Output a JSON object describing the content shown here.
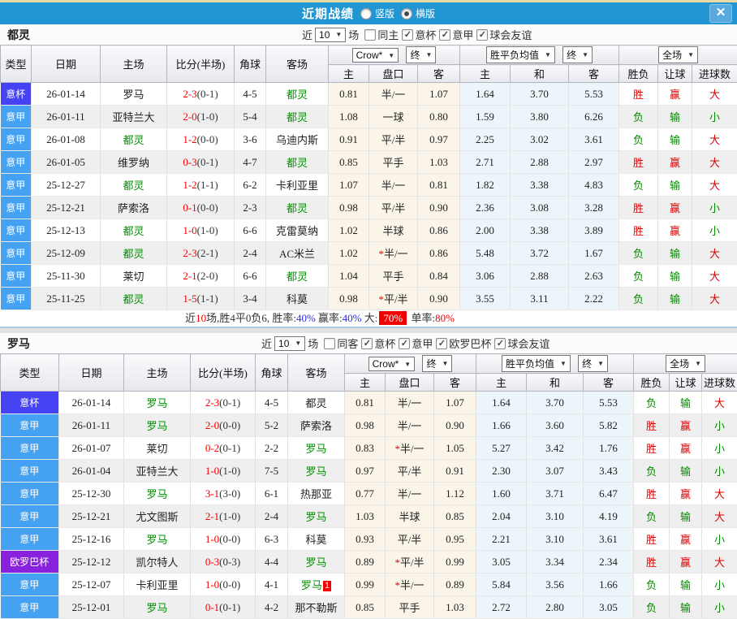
{
  "titlebar": {
    "title": "近期战绩",
    "layout_options": [
      {
        "label": "竖版",
        "selected": false
      },
      {
        "label": "横版",
        "selected": true
      }
    ],
    "close": "✕"
  },
  "colors": {
    "titlebar_bg": "#2196d3",
    "league": {
      "意甲": "#45a1f1",
      "意杯": "#4442f2",
      "欧罗巴杯": "#8a22dd"
    },
    "win_red": "#dd0000",
    "lose_green": "#038a00",
    "team_green": "#009100",
    "score_red": "#f40000",
    "odds_col_bg": "#fbf5e9",
    "mean_col_bg": "#ecf5fa"
  },
  "table_header": {
    "cols": [
      "类型",
      "日期",
      "主场",
      "比分(半场)",
      "角球",
      "客场"
    ],
    "odds_group": {
      "source": "Crow*",
      "time": "终"
    },
    "mean_group": {
      "source": "胜平负均值",
      "time": "终"
    },
    "result_group": {
      "scope": "全场"
    },
    "sub": [
      "主",
      "盘口",
      "客",
      "主",
      "和",
      "客",
      "胜负",
      "让球",
      "进球数"
    ]
  },
  "teams": [
    {
      "name": "都灵",
      "filters": {
        "near": "近",
        "count": "10",
        "games": "场",
        "checks": [
          {
            "label": "同主",
            "checked": false
          },
          {
            "label": "意杯",
            "checked": true
          },
          {
            "label": "意甲",
            "checked": true
          },
          {
            "label": "球会友谊",
            "checked": true
          }
        ]
      },
      "rows": [
        {
          "league": "意杯",
          "date": "26-01-14",
          "home": "罗马",
          "homeGreen": false,
          "score": "2-3",
          "half": "(0-1)",
          "corner": "4-5",
          "away": "都灵",
          "awayGreen": true,
          "awayBadge": null,
          "oddsHome": "0.81",
          "handicap": "半/一",
          "handicapStar": false,
          "oddsAway": "1.07",
          "meanHome": "1.64",
          "meanDraw": "3.70",
          "meanAway": "5.53",
          "resWDL": "胜",
          "resHandicap": "赢",
          "resGoals": "大"
        },
        {
          "league": "意甲",
          "date": "26-01-11",
          "home": "亚特兰大",
          "homeGreen": false,
          "score": "2-0",
          "half": "(1-0)",
          "corner": "5-4",
          "away": "都灵",
          "awayGreen": true,
          "awayBadge": null,
          "oddsHome": "1.08",
          "handicap": "一球",
          "handicapStar": false,
          "oddsAway": "0.80",
          "meanHome": "1.59",
          "meanDraw": "3.80",
          "meanAway": "6.26",
          "resWDL": "负",
          "resHandicap": "输",
          "resGoals": "小"
        },
        {
          "league": "意甲",
          "date": "26-01-08",
          "home": "都灵",
          "homeGreen": true,
          "score": "1-2",
          "half": "(0-0)",
          "corner": "3-6",
          "away": "乌迪内斯",
          "awayGreen": false,
          "awayBadge": null,
          "oddsHome": "0.91",
          "handicap": "平/半",
          "handicapStar": false,
          "oddsAway": "0.97",
          "meanHome": "2.25",
          "meanDraw": "3.02",
          "meanAway": "3.61",
          "resWDL": "负",
          "resHandicap": "输",
          "resGoals": "大"
        },
        {
          "league": "意甲",
          "date": "26-01-05",
          "home": "维罗纳",
          "homeGreen": false,
          "score": "0-3",
          "half": "(0-1)",
          "corner": "4-7",
          "away": "都灵",
          "awayGreen": true,
          "awayBadge": null,
          "oddsHome": "0.85",
          "handicap": "平手",
          "handicapStar": false,
          "oddsAway": "1.03",
          "meanHome": "2.71",
          "meanDraw": "2.88",
          "meanAway": "2.97",
          "resWDL": "胜",
          "resHandicap": "赢",
          "resGoals": "大"
        },
        {
          "league": "意甲",
          "date": "25-12-27",
          "home": "都灵",
          "homeGreen": true,
          "score": "1-2",
          "half": "(1-1)",
          "corner": "6-2",
          "away": "卡利亚里",
          "awayGreen": false,
          "awayBadge": null,
          "oddsHome": "1.07",
          "handicap": "半/一",
          "handicapStar": false,
          "oddsAway": "0.81",
          "meanHome": "1.82",
          "meanDraw": "3.38",
          "meanAway": "4.83",
          "resWDL": "负",
          "resHandicap": "输",
          "resGoals": "大"
        },
        {
          "league": "意甲",
          "date": "25-12-21",
          "home": "萨索洛",
          "homeGreen": false,
          "score": "0-1",
          "half": "(0-0)",
          "corner": "2-3",
          "away": "都灵",
          "awayGreen": true,
          "awayBadge": null,
          "oddsHome": "0.98",
          "handicap": "平/半",
          "handicapStar": false,
          "oddsAway": "0.90",
          "meanHome": "2.36",
          "meanDraw": "3.08",
          "meanAway": "3.28",
          "resWDL": "胜",
          "resHandicap": "赢",
          "resGoals": "小"
        },
        {
          "league": "意甲",
          "date": "25-12-13",
          "home": "都灵",
          "homeGreen": true,
          "score": "1-0",
          "half": "(1-0)",
          "corner": "6-6",
          "away": "克雷莫纳",
          "awayGreen": false,
          "awayBadge": null,
          "oddsHome": "1.02",
          "handicap": "半球",
          "handicapStar": false,
          "oddsAway": "0.86",
          "meanHome": "2.00",
          "meanDraw": "3.38",
          "meanAway": "3.89",
          "resWDL": "胜",
          "resHandicap": "赢",
          "resGoals": "小"
        },
        {
          "league": "意甲",
          "date": "25-12-09",
          "home": "都灵",
          "homeGreen": true,
          "score": "2-3",
          "half": "(2-1)",
          "corner": "2-4",
          "away": "AC米兰",
          "awayGreen": false,
          "awayBadge": null,
          "oddsHome": "1.02",
          "handicap": "半/一",
          "handicapStar": true,
          "oddsAway": "0.86",
          "meanHome": "5.48",
          "meanDraw": "3.72",
          "meanAway": "1.67",
          "resWDL": "负",
          "resHandicap": "输",
          "resGoals": "大"
        },
        {
          "league": "意甲",
          "date": "25-11-30",
          "home": "莱切",
          "homeGreen": false,
          "score": "2-1",
          "half": "(2-0)",
          "corner": "6-6",
          "away": "都灵",
          "awayGreen": true,
          "awayBadge": null,
          "oddsHome": "1.04",
          "handicap": "平手",
          "handicapStar": false,
          "oddsAway": "0.84",
          "meanHome": "3.06",
          "meanDraw": "2.88",
          "meanAway": "2.63",
          "resWDL": "负",
          "resHandicap": "输",
          "resGoals": "大"
        },
        {
          "league": "意甲",
          "date": "25-11-25",
          "home": "都灵",
          "homeGreen": true,
          "score": "1-5",
          "half": "(1-1)",
          "corner": "3-4",
          "away": "科莫",
          "awayGreen": false,
          "awayBadge": null,
          "oddsHome": "0.98",
          "handicap": "平/半",
          "handicapStar": true,
          "oddsAway": "0.90",
          "meanHome": "3.55",
          "meanDraw": "3.11",
          "meanAway": "2.22",
          "resWDL": "负",
          "resHandicap": "输",
          "resGoals": "大"
        }
      ],
      "summary": [
        {
          "t": "近",
          "s": "k"
        },
        {
          "t": "10",
          "s": "r"
        },
        {
          "t": "场,胜4平0负6, 胜率:",
          "s": "k"
        },
        {
          "t": "40%",
          "s": "b"
        },
        {
          "t": " 赢率:",
          "s": "k"
        },
        {
          "t": "40%",
          "s": "b"
        },
        {
          "t": " 大:",
          "s": "k"
        },
        {
          "t": "70%",
          "s": "badge"
        },
        {
          "t": " 单率:",
          "s": "k"
        },
        {
          "t": "80%",
          "s": "r"
        }
      ]
    },
    {
      "name": "罗马",
      "filters": {
        "near": "近",
        "count": "10",
        "games": "场",
        "checks": [
          {
            "label": "同客",
            "checked": false
          },
          {
            "label": "意杯",
            "checked": true
          },
          {
            "label": "意甲",
            "checked": true
          },
          {
            "label": "欧罗巴杯",
            "checked": true
          },
          {
            "label": "球会友谊",
            "checked": true
          }
        ]
      },
      "rows": [
        {
          "league": "意杯",
          "date": "26-01-14",
          "home": "罗马",
          "homeGreen": true,
          "score": "2-3",
          "half": "(0-1)",
          "corner": "4-5",
          "away": "都灵",
          "awayGreen": false,
          "awayBadge": null,
          "oddsHome": "0.81",
          "handicap": "半/一",
          "handicapStar": false,
          "oddsAway": "1.07",
          "meanHome": "1.64",
          "meanDraw": "3.70",
          "meanAway": "5.53",
          "resWDL": "负",
          "resHandicap": "输",
          "resGoals": "大"
        },
        {
          "league": "意甲",
          "date": "26-01-11",
          "home": "罗马",
          "homeGreen": true,
          "score": "2-0",
          "half": "(0-0)",
          "corner": "5-2",
          "away": "萨索洛",
          "awayGreen": false,
          "awayBadge": null,
          "oddsHome": "0.98",
          "handicap": "半/一",
          "handicapStar": false,
          "oddsAway": "0.90",
          "meanHome": "1.66",
          "meanDraw": "3.60",
          "meanAway": "5.82",
          "resWDL": "胜",
          "resHandicap": "赢",
          "resGoals": "小"
        },
        {
          "league": "意甲",
          "date": "26-01-07",
          "home": "莱切",
          "homeGreen": false,
          "score": "0-2",
          "half": "(0-1)",
          "corner": "2-2",
          "away": "罗马",
          "awayGreen": true,
          "awayBadge": null,
          "oddsHome": "0.83",
          "handicap": "半/一",
          "handicapStar": true,
          "oddsAway": "1.05",
          "meanHome": "5.27",
          "meanDraw": "3.42",
          "meanAway": "1.76",
          "resWDL": "胜",
          "resHandicap": "赢",
          "resGoals": "小"
        },
        {
          "league": "意甲",
          "date": "26-01-04",
          "home": "亚特兰大",
          "homeGreen": false,
          "score": "1-0",
          "half": "(1-0)",
          "corner": "7-5",
          "away": "罗马",
          "awayGreen": true,
          "awayBadge": null,
          "oddsHome": "0.97",
          "handicap": "平/半",
          "handicapStar": false,
          "oddsAway": "0.91",
          "meanHome": "2.30",
          "meanDraw": "3.07",
          "meanAway": "3.43",
          "resWDL": "负",
          "resHandicap": "输",
          "resGoals": "小"
        },
        {
          "league": "意甲",
          "date": "25-12-30",
          "home": "罗马",
          "homeGreen": true,
          "score": "3-1",
          "half": "(3-0)",
          "corner": "6-1",
          "away": "热那亚",
          "awayGreen": false,
          "awayBadge": null,
          "oddsHome": "0.77",
          "handicap": "半/一",
          "handicapStar": false,
          "oddsAway": "1.12",
          "meanHome": "1.60",
          "meanDraw": "3.71",
          "meanAway": "6.47",
          "resWDL": "胜",
          "resHandicap": "赢",
          "resGoals": "大"
        },
        {
          "league": "意甲",
          "date": "25-12-21",
          "home": "尤文图斯",
          "homeGreen": false,
          "score": "2-1",
          "half": "(1-0)",
          "corner": "2-4",
          "away": "罗马",
          "awayGreen": true,
          "awayBadge": null,
          "oddsHome": "1.03",
          "handicap": "半球",
          "handicapStar": false,
          "oddsAway": "0.85",
          "meanHome": "2.04",
          "meanDraw": "3.10",
          "meanAway": "4.19",
          "resWDL": "负",
          "resHandicap": "输",
          "resGoals": "大"
        },
        {
          "league": "意甲",
          "date": "25-12-16",
          "home": "罗马",
          "homeGreen": true,
          "score": "1-0",
          "half": "(0-0)",
          "corner": "6-3",
          "away": "科莫",
          "awayGreen": false,
          "awayBadge": null,
          "oddsHome": "0.93",
          "handicap": "平/半",
          "handicapStar": false,
          "oddsAway": "0.95",
          "meanHome": "2.21",
          "meanDraw": "3.10",
          "meanAway": "3.61",
          "resWDL": "胜",
          "resHandicap": "赢",
          "resGoals": "小"
        },
        {
          "league": "欧罗巴杯",
          "date": "25-12-12",
          "home": "凯尔特人",
          "homeGreen": false,
          "score": "0-3",
          "half": "(0-3)",
          "corner": "4-4",
          "away": "罗马",
          "awayGreen": true,
          "awayBadge": null,
          "oddsHome": "0.89",
          "handicap": "平/半",
          "handicapStar": true,
          "oddsAway": "0.99",
          "meanHome": "3.05",
          "meanDraw": "3.34",
          "meanAway": "2.34",
          "resWDL": "胜",
          "resHandicap": "赢",
          "resGoals": "大"
        },
        {
          "league": "意甲",
          "date": "25-12-07",
          "home": "卡利亚里",
          "homeGreen": false,
          "score": "1-0",
          "half": "(0-0)",
          "corner": "4-1",
          "away": "罗马",
          "awayGreen": true,
          "awayBadge": "1",
          "oddsHome": "0.99",
          "handicap": "半/一",
          "handicapStar": true,
          "oddsAway": "0.89",
          "meanHome": "5.84",
          "meanDraw": "3.56",
          "meanAway": "1.66",
          "resWDL": "负",
          "resHandicap": "输",
          "resGoals": "小"
        },
        {
          "league": "意甲",
          "date": "25-12-01",
          "home": "罗马",
          "homeGreen": true,
          "score": "0-1",
          "half": "(0-1)",
          "corner": "4-2",
          "away": "那不勒斯",
          "awayGreen": false,
          "awayBadge": null,
          "oddsHome": "0.85",
          "handicap": "平手",
          "handicapStar": false,
          "oddsAway": "1.03",
          "meanHome": "2.72",
          "meanDraw": "2.80",
          "meanAway": "3.05",
          "resWDL": "负",
          "resHandicap": "输",
          "resGoals": "小"
        }
      ],
      "summary": null
    }
  ]
}
